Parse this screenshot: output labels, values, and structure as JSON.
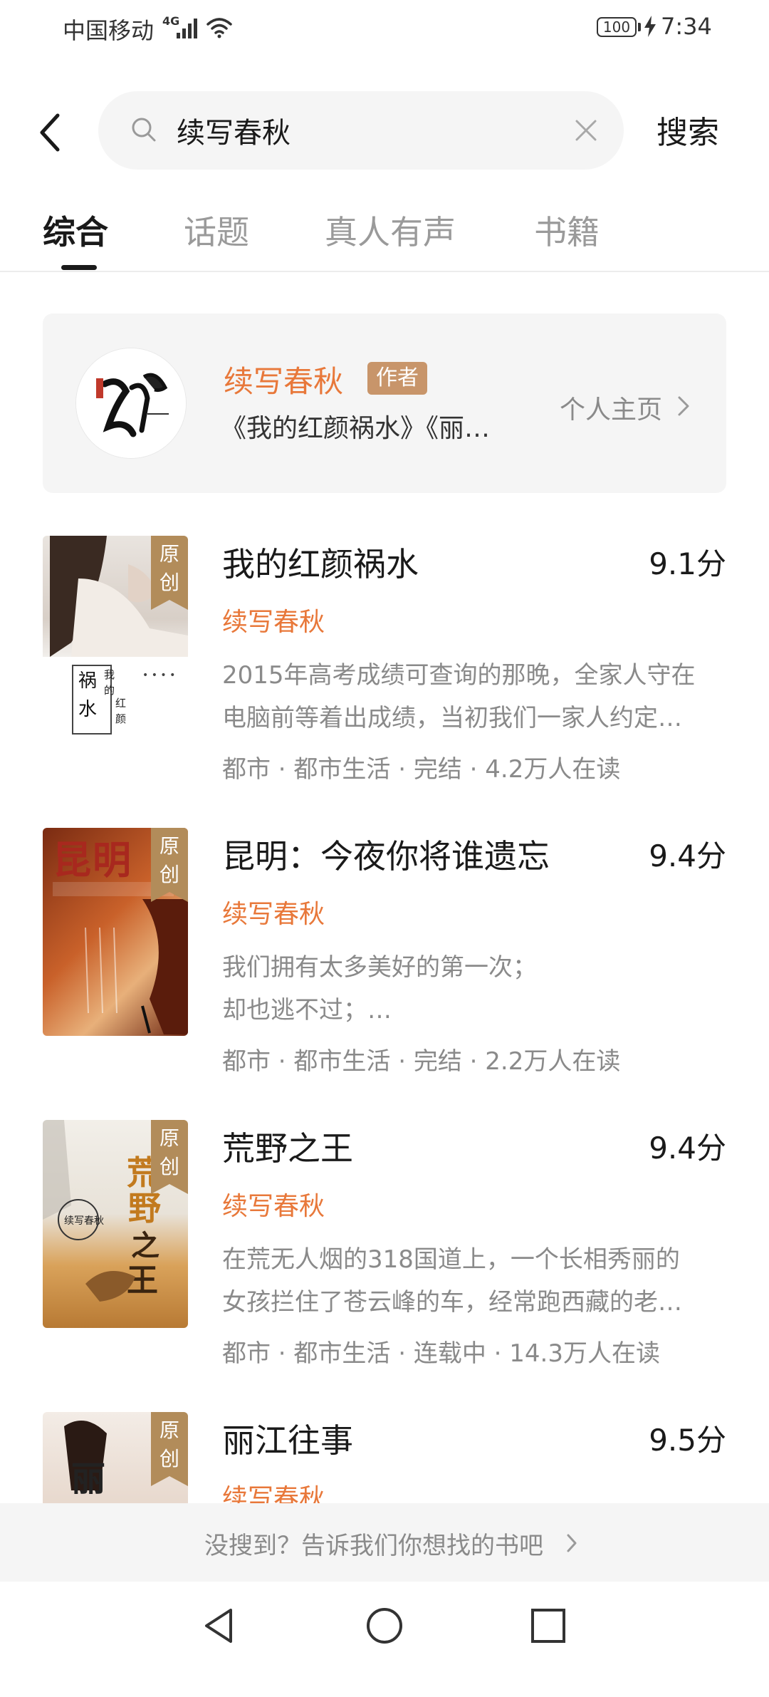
{
  "status_bar": {
    "carrier": "中国移动",
    "network": "4G",
    "battery": "100",
    "time": "7:34"
  },
  "search": {
    "query": "续写春秋",
    "placeholder": "",
    "submit_label": "搜索"
  },
  "tabs": [
    {
      "label": "综合",
      "active": true
    },
    {
      "label": "话题",
      "active": false
    },
    {
      "label": "真人有声",
      "active": false
    },
    {
      "label": "书籍",
      "active": false
    }
  ],
  "author_card": {
    "name": "续写春秋",
    "tag": "作者",
    "works": "《我的红颜祸水》《丽…",
    "home_link": "个人主页"
  },
  "books": [
    {
      "title": "我的红颜祸水",
      "score": "9.1分",
      "author": "续写春秋",
      "badge": [
        "原",
        "创"
      ],
      "desc": [
        "2015年高考成绩可查询的那晚，全家人守在",
        "电脑前等着出成绩，当初我们一家人约定…"
      ],
      "meta": "都市 · 都市生活 · 完结 · 4.2万人在读"
    },
    {
      "title": "昆明：今夜你将谁遗忘",
      "score": "9.4分",
      "author": "续写春秋",
      "badge": [
        "原",
        "创"
      ],
      "desc": [
        "我们拥有太多美好的第一次；",
        "却也逃不过；…"
      ],
      "meta": "都市 · 都市生活 · 完结 · 2.2万人在读"
    },
    {
      "title": "荒野之王",
      "score": "9.4分",
      "author": "续写春秋",
      "badge": [
        "原",
        "创"
      ],
      "desc": [
        "在荒无人烟的318国道上，一个长相秀丽的",
        "女孩拦住了苍云峰的车，经常跑西藏的老…"
      ],
      "meta": "都市 · 都市生活 · 连载中 · 14.3万人在读"
    },
    {
      "title": "丽江往事",
      "score": "9.5分",
      "author": "续写春秋",
      "badge": [
        "原",
        "创"
      ],
      "desc": [
        "",
        ""
      ],
      "meta": ""
    }
  ],
  "footer_hint": "没搜到？告诉我们你想找的书吧",
  "colors": {
    "accent": "#e8783a",
    "tag": "#c8956a",
    "badge": "#b28c5a",
    "muted": "#8a8a8a",
    "panel": "#f5f5f5"
  },
  "icons": [
    "back-arrow-icon",
    "search-icon",
    "clear-icon",
    "chevron-right-icon",
    "nav-back-icon",
    "nav-home-icon",
    "nav-recent-icon",
    "wifi-icon",
    "signal-icon",
    "battery-icon",
    "charging-icon"
  ]
}
